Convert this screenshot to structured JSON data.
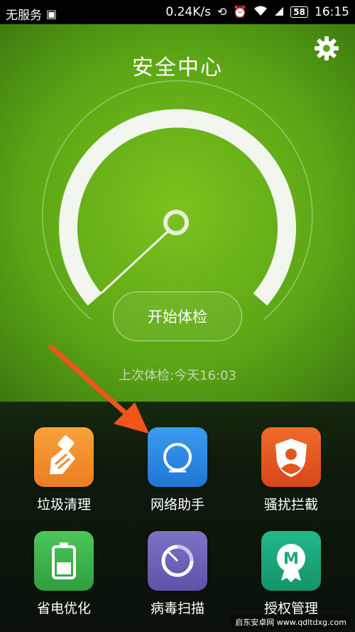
{
  "status_bar": {
    "carrier": "无服务",
    "speed": "0.24K/s",
    "battery": "58",
    "time": "16:15",
    "icons": [
      "image-icon",
      "sync-icon",
      "alarm-icon",
      "wifi-icon",
      "signal-icon"
    ]
  },
  "header": {
    "title": "安全中心",
    "settings_icon": "gear-icon"
  },
  "gauge": {
    "button_label": "开始体检",
    "last_check": "上次体检:今天16:03"
  },
  "features": [
    {
      "label": "垃圾清理",
      "icon": "broom-icon",
      "color": "#f0892a"
    },
    {
      "label": "网络助手",
      "icon": "network-ring-icon",
      "color": "#2d8ae6"
    },
    {
      "label": "骚扰拦截",
      "icon": "shield-user-icon",
      "color": "#e2561c"
    },
    {
      "label": "省电优化",
      "icon": "battery-icon",
      "color": "#3bb14a"
    },
    {
      "label": "病毒扫描",
      "icon": "scan-icon",
      "color": "#6e63b8"
    },
    {
      "label": "授权管理",
      "icon": "m-badge-icon",
      "color": "#1aa57a"
    }
  ],
  "watermark": {
    "text": "启东安卓网 www.qdltdxg.com"
  }
}
